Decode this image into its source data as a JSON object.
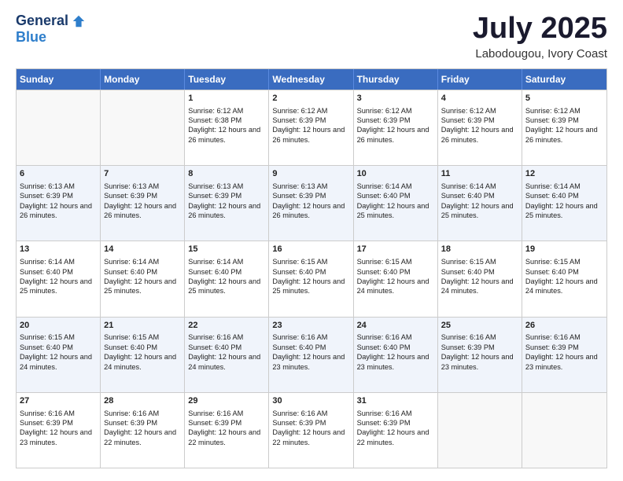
{
  "logo": {
    "general": "General",
    "blue": "Blue"
  },
  "title": "July 2025",
  "subtitle": "Labodougou, Ivory Coast",
  "days": [
    "Sunday",
    "Monday",
    "Tuesday",
    "Wednesday",
    "Thursday",
    "Friday",
    "Saturday"
  ],
  "weeks": [
    [
      {
        "day": "",
        "sunrise": "",
        "sunset": "",
        "daylight": ""
      },
      {
        "day": "",
        "sunrise": "",
        "sunset": "",
        "daylight": ""
      },
      {
        "day": "1",
        "sunrise": "Sunrise: 6:12 AM",
        "sunset": "Sunset: 6:38 PM",
        "daylight": "Daylight: 12 hours and 26 minutes."
      },
      {
        "day": "2",
        "sunrise": "Sunrise: 6:12 AM",
        "sunset": "Sunset: 6:39 PM",
        "daylight": "Daylight: 12 hours and 26 minutes."
      },
      {
        "day": "3",
        "sunrise": "Sunrise: 6:12 AM",
        "sunset": "Sunset: 6:39 PM",
        "daylight": "Daylight: 12 hours and 26 minutes."
      },
      {
        "day": "4",
        "sunrise": "Sunrise: 6:12 AM",
        "sunset": "Sunset: 6:39 PM",
        "daylight": "Daylight: 12 hours and 26 minutes."
      },
      {
        "day": "5",
        "sunrise": "Sunrise: 6:12 AM",
        "sunset": "Sunset: 6:39 PM",
        "daylight": "Daylight: 12 hours and 26 minutes."
      }
    ],
    [
      {
        "day": "6",
        "sunrise": "Sunrise: 6:13 AM",
        "sunset": "Sunset: 6:39 PM",
        "daylight": "Daylight: 12 hours and 26 minutes."
      },
      {
        "day": "7",
        "sunrise": "Sunrise: 6:13 AM",
        "sunset": "Sunset: 6:39 PM",
        "daylight": "Daylight: 12 hours and 26 minutes."
      },
      {
        "day": "8",
        "sunrise": "Sunrise: 6:13 AM",
        "sunset": "Sunset: 6:39 PM",
        "daylight": "Daylight: 12 hours and 26 minutes."
      },
      {
        "day": "9",
        "sunrise": "Sunrise: 6:13 AM",
        "sunset": "Sunset: 6:39 PM",
        "daylight": "Daylight: 12 hours and 26 minutes."
      },
      {
        "day": "10",
        "sunrise": "Sunrise: 6:14 AM",
        "sunset": "Sunset: 6:40 PM",
        "daylight": "Daylight: 12 hours and 25 minutes."
      },
      {
        "day": "11",
        "sunrise": "Sunrise: 6:14 AM",
        "sunset": "Sunset: 6:40 PM",
        "daylight": "Daylight: 12 hours and 25 minutes."
      },
      {
        "day": "12",
        "sunrise": "Sunrise: 6:14 AM",
        "sunset": "Sunset: 6:40 PM",
        "daylight": "Daylight: 12 hours and 25 minutes."
      }
    ],
    [
      {
        "day": "13",
        "sunrise": "Sunrise: 6:14 AM",
        "sunset": "Sunset: 6:40 PM",
        "daylight": "Daylight: 12 hours and 25 minutes."
      },
      {
        "day": "14",
        "sunrise": "Sunrise: 6:14 AM",
        "sunset": "Sunset: 6:40 PM",
        "daylight": "Daylight: 12 hours and 25 minutes."
      },
      {
        "day": "15",
        "sunrise": "Sunrise: 6:14 AM",
        "sunset": "Sunset: 6:40 PM",
        "daylight": "Daylight: 12 hours and 25 minutes."
      },
      {
        "day": "16",
        "sunrise": "Sunrise: 6:15 AM",
        "sunset": "Sunset: 6:40 PM",
        "daylight": "Daylight: 12 hours and 25 minutes."
      },
      {
        "day": "17",
        "sunrise": "Sunrise: 6:15 AM",
        "sunset": "Sunset: 6:40 PM",
        "daylight": "Daylight: 12 hours and 24 minutes."
      },
      {
        "day": "18",
        "sunrise": "Sunrise: 6:15 AM",
        "sunset": "Sunset: 6:40 PM",
        "daylight": "Daylight: 12 hours and 24 minutes."
      },
      {
        "day": "19",
        "sunrise": "Sunrise: 6:15 AM",
        "sunset": "Sunset: 6:40 PM",
        "daylight": "Daylight: 12 hours and 24 minutes."
      }
    ],
    [
      {
        "day": "20",
        "sunrise": "Sunrise: 6:15 AM",
        "sunset": "Sunset: 6:40 PM",
        "daylight": "Daylight: 12 hours and 24 minutes."
      },
      {
        "day": "21",
        "sunrise": "Sunrise: 6:15 AM",
        "sunset": "Sunset: 6:40 PM",
        "daylight": "Daylight: 12 hours and 24 minutes."
      },
      {
        "day": "22",
        "sunrise": "Sunrise: 6:16 AM",
        "sunset": "Sunset: 6:40 PM",
        "daylight": "Daylight: 12 hours and 24 minutes."
      },
      {
        "day": "23",
        "sunrise": "Sunrise: 6:16 AM",
        "sunset": "Sunset: 6:40 PM",
        "daylight": "Daylight: 12 hours and 23 minutes."
      },
      {
        "day": "24",
        "sunrise": "Sunrise: 6:16 AM",
        "sunset": "Sunset: 6:40 PM",
        "daylight": "Daylight: 12 hours and 23 minutes."
      },
      {
        "day": "25",
        "sunrise": "Sunrise: 6:16 AM",
        "sunset": "Sunset: 6:39 PM",
        "daylight": "Daylight: 12 hours and 23 minutes."
      },
      {
        "day": "26",
        "sunrise": "Sunrise: 6:16 AM",
        "sunset": "Sunset: 6:39 PM",
        "daylight": "Daylight: 12 hours and 23 minutes."
      }
    ],
    [
      {
        "day": "27",
        "sunrise": "Sunrise: 6:16 AM",
        "sunset": "Sunset: 6:39 PM",
        "daylight": "Daylight: 12 hours and 23 minutes."
      },
      {
        "day": "28",
        "sunrise": "Sunrise: 6:16 AM",
        "sunset": "Sunset: 6:39 PM",
        "daylight": "Daylight: 12 hours and 22 minutes."
      },
      {
        "day": "29",
        "sunrise": "Sunrise: 6:16 AM",
        "sunset": "Sunset: 6:39 PM",
        "daylight": "Daylight: 12 hours and 22 minutes."
      },
      {
        "day": "30",
        "sunrise": "Sunrise: 6:16 AM",
        "sunset": "Sunset: 6:39 PM",
        "daylight": "Daylight: 12 hours and 22 minutes."
      },
      {
        "day": "31",
        "sunrise": "Sunrise: 6:16 AM",
        "sunset": "Sunset: 6:39 PM",
        "daylight": "Daylight: 12 hours and 22 minutes."
      },
      {
        "day": "",
        "sunrise": "",
        "sunset": "",
        "daylight": ""
      },
      {
        "day": "",
        "sunrise": "",
        "sunset": "",
        "daylight": ""
      }
    ]
  ]
}
